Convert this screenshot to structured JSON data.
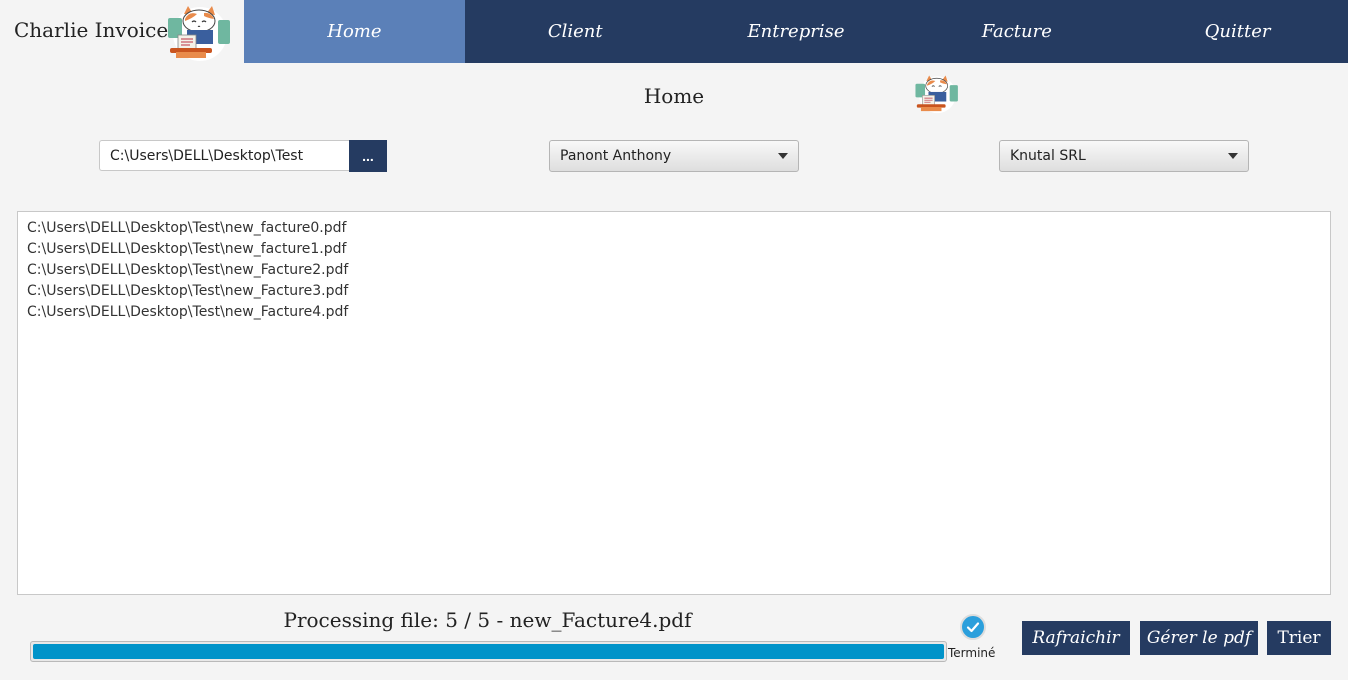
{
  "app": {
    "title": "Charlie Invoice",
    "logo_icon": "cat-invoice-logo-icon"
  },
  "nav": {
    "items": [
      {
        "label": "Home",
        "active": true
      },
      {
        "label": "Client",
        "active": false
      },
      {
        "label": "Entreprise",
        "active": false
      },
      {
        "label": "Facture",
        "active": false
      },
      {
        "label": "Quitter",
        "active": false
      }
    ]
  },
  "page": {
    "title": "Home"
  },
  "folder": {
    "value": "C:\\Users\\DELL\\Desktop\\Test",
    "browse_label": "..."
  },
  "client_select": {
    "value": "Panont Anthony"
  },
  "company_select": {
    "value": "Knutal SRL"
  },
  "files": [
    "C:\\Users\\DELL\\Desktop\\Test\\new_facture0.pdf",
    "C:\\Users\\DELL\\Desktop\\Test\\new_facture1.pdf",
    "C:\\Users\\DELL\\Desktop\\Test\\new_Facture2.pdf",
    "C:\\Users\\DELL\\Desktop\\Test\\new_Facture3.pdf",
    "C:\\Users\\DELL\\Desktop\\Test\\new_Facture4.pdf"
  ],
  "status": {
    "processing_text": "Processing file: 5 / 5 - new_Facture4.pdf",
    "progress": 1.0,
    "done_label": "Terminé",
    "done_icon": "check-circle-icon"
  },
  "actions": {
    "refresh": "Rafraichir",
    "manage_pdf": "Gérer le pdf",
    "sort": "Trier"
  },
  "colors": {
    "nav_bg": "#253b61",
    "nav_active": "#5b80b8",
    "progress": "#0093c9",
    "check": "#2b9fdc"
  }
}
